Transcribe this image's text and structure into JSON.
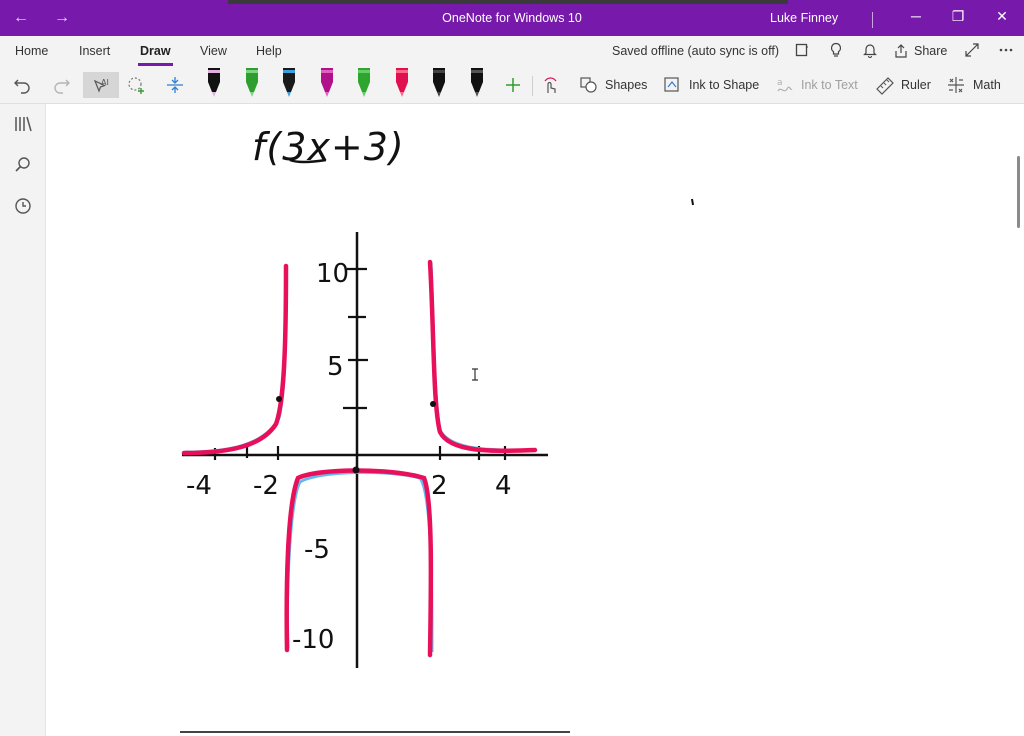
{
  "window": {
    "title": "OneNote for Windows 10",
    "user": "Luke Finney",
    "back_icon": "←",
    "forward_icon": "→",
    "minimize_icon": "─",
    "restore_icon": "❐",
    "close_icon": "✕"
  },
  "ribbon": {
    "tabs": [
      {
        "label": "Home"
      },
      {
        "label": "Insert"
      },
      {
        "label": "Draw"
      },
      {
        "label": "View"
      },
      {
        "label": "Help"
      }
    ],
    "active_tab": "Draw",
    "status": "Saved offline (auto sync is off)",
    "share_label": "Share",
    "accent_color": "#7719aa"
  },
  "toolbar": {
    "shapes_label": "Shapes",
    "ink_to_shape_label": "Ink to Shape",
    "ink_to_text_label": "Ink to Text",
    "ruler_label": "Ruler",
    "math_label": "Math",
    "pens": [
      {
        "color": "#111111",
        "tip": "#e0b0e0"
      },
      {
        "color": "#2e9e2e",
        "tip": "#7fd47f"
      },
      {
        "color": "#1a1a1a",
        "tip": "#3aa0e0"
      },
      {
        "color": "#b0108a",
        "tip": "#e060c0"
      },
      {
        "color": "#2ea52e",
        "tip": "#66cc66"
      },
      {
        "color": "#e01050",
        "tip": "#ff6688"
      },
      {
        "color": "#111111",
        "tip": "#444444"
      },
      {
        "color": "#111111",
        "tip": "#555555"
      }
    ]
  },
  "canvas": {
    "handwritten_expression": "f(3x+3)",
    "graph": {
      "y_tick_labels": [
        "10",
        "5",
        "-5",
        "-10"
      ],
      "x_tick_labels": [
        "-4",
        "-2",
        "2",
        "4"
      ],
      "curve_color": "#e8105a",
      "sketch_color": "#66b8ee"
    }
  }
}
